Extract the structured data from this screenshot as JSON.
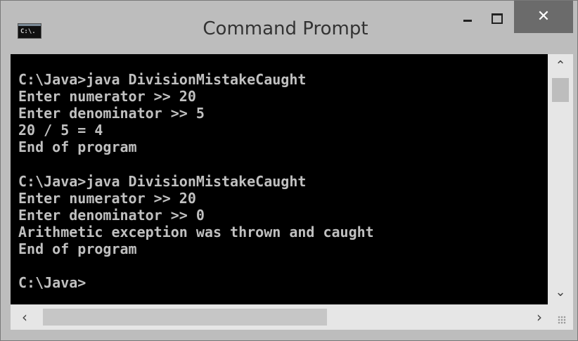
{
  "window": {
    "title": "Command Prompt",
    "app_icon_label": "C:\\.",
    "icon": "cmd-icon"
  },
  "controls": {
    "minimize_icon": "minimize-icon",
    "maximize_icon": "maximize-icon",
    "close_glyph": "✕",
    "close_color": "#6b6b6b"
  },
  "console": {
    "background": "#000000",
    "foreground": "#c0c0c0",
    "lines": [
      "C:\\Java>java DivisionMistakeCaught",
      "Enter numerator >> 20",
      "Enter denominator >> 5",
      "20 / 5 = 4",
      "End of program",
      "",
      "C:\\Java>java DivisionMistakeCaught",
      "Enter numerator >> 20",
      "Enter denominator >> 0",
      "Arithmetic exception was thrown and caught",
      "End of program",
      "",
      "C:\\Java>"
    ]
  },
  "scrollbars": {
    "up_glyph": "⌃",
    "down_glyph": "⌄",
    "left_glyph": "‹",
    "right_glyph": "›"
  }
}
